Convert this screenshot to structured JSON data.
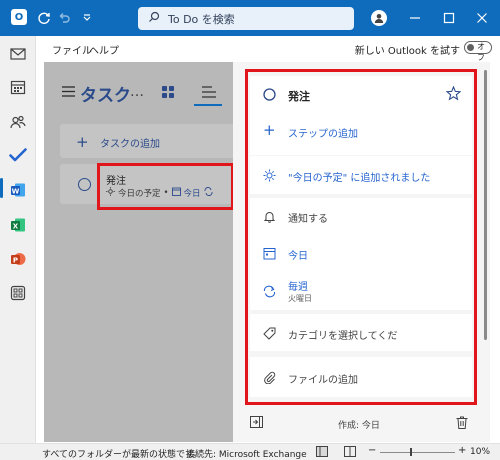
{
  "titlebar": {
    "search_placeholder": "To Do を検索"
  },
  "menubar": {
    "file": "ファイル",
    "help": "ヘルプ",
    "new_outlook": "新しい Outlook を試す",
    "toggle_label": "オフ"
  },
  "list": {
    "title": "タスク",
    "ellipsis": "…",
    "add_task": "タスクの追加"
  },
  "task": {
    "title": "発注",
    "meta_myday": "今日の予定",
    "meta_sep": "•",
    "meta_due": "今日"
  },
  "detail": {
    "task_title": "発注",
    "add_step": "ステップの追加",
    "added_to_myday": "\"今日の予定\" に追加されました",
    "remind": "通知する",
    "due_today": "今日",
    "repeat": "毎週",
    "repeat_sub": "火曜日",
    "category": "カテゴリを選択してくだ",
    "add_file": "ファイルの追加",
    "created": "作成: 今日"
  },
  "statusbar": {
    "folders": "すべてのフォルダーが最新の状態です。",
    "connection": "接続先: Microsoft Exchange",
    "zoom_minus": "−",
    "zoom_plus": "+",
    "zoom": "10%"
  },
  "colors": {
    "accent": "#0f6cbd",
    "highlight": "#e0161b",
    "todo_blue": "#2b4a8a"
  }
}
